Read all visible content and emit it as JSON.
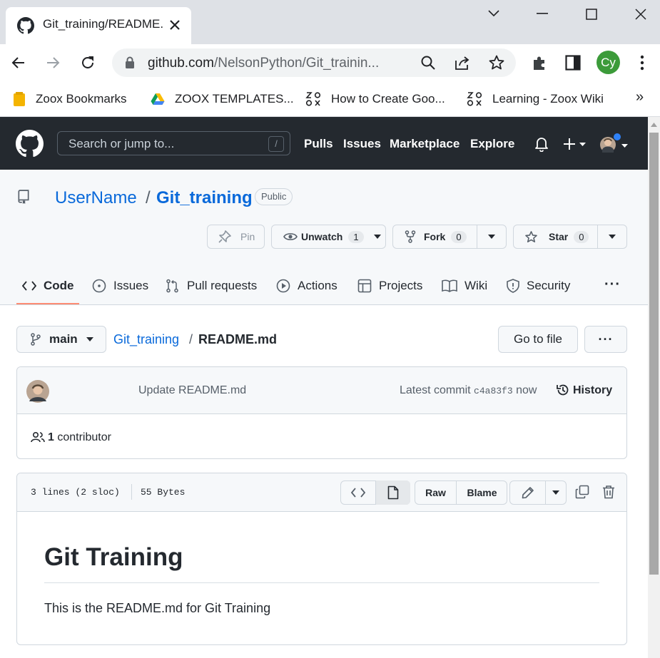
{
  "browser": {
    "tab_title": "Git_training/README.md",
    "url_host": "github.com",
    "url_path": "/NelsonPython/Git_trainin...",
    "profile_initials": "Cy",
    "bookmarks": [
      {
        "label": "Zoox Bookmarks",
        "icon": "folder-icon"
      },
      {
        "label": "ZOOX TEMPLATES...",
        "icon": "google-drive-icon"
      },
      {
        "label": "How to Create Goo...",
        "icon": "zoox-icon"
      },
      {
        "label": "Learning - Zoox Wiki",
        "icon": "zoox-icon"
      }
    ],
    "bookmarks_overflow": "»"
  },
  "gh_header": {
    "search_placeholder": "Search or jump to...",
    "search_shortcut": "/",
    "nav": [
      "Pulls",
      "Issues",
      "Marketplace",
      "Explore"
    ]
  },
  "repo": {
    "owner": "UserName",
    "separator": "/",
    "name": "Git_training",
    "visibility": "Public",
    "pin_label": "Pin",
    "unwatch_label": "Unwatch",
    "watch_count": "1",
    "fork_label": "Fork",
    "fork_count": "0",
    "star_label": "Star",
    "star_count": "0",
    "tabs": [
      "Code",
      "Issues",
      "Pull requests",
      "Actions",
      "Projects",
      "Wiki",
      "Security"
    ],
    "more": "···"
  },
  "file_nav": {
    "branch": "main",
    "path_repo": "Git_training",
    "path_sep": "/",
    "path_file": "README.md",
    "go_to_file": "Go to file",
    "more": "···"
  },
  "commit": {
    "message": "Update README.md",
    "latest_label": "Latest commit",
    "sha": "c4a83f3",
    "time": "now",
    "history_label": "History",
    "contributors_count": "1",
    "contributors_label": "contributor"
  },
  "file": {
    "lines_info": "3 lines (2 sloc)",
    "size": "55 Bytes",
    "raw_label": "Raw",
    "blame_label": "Blame",
    "heading": "Git Training",
    "body": "This is the README.md for Git Training"
  },
  "colors": {
    "link": "#0969da",
    "header_bg": "#24292f",
    "active_tab_underline": "#fd8c73",
    "profile_green": "#3c9b3a"
  }
}
